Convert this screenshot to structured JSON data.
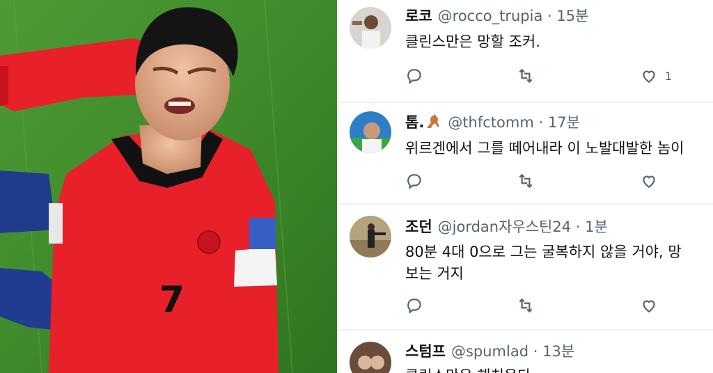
{
  "tweets": [
    {
      "name": "로코",
      "handle": "@rocco_trupia",
      "time": "15분",
      "text": "클린스만은 망할 조커.",
      "text2": "",
      "likes": "1"
    },
    {
      "name": "톰.",
      "handle": "@thfctomm",
      "time": "17분",
      "text": "위르겐에서 그를 떼어내라 이 노발대발한 놈이",
      "text2": "",
      "likes": ""
    },
    {
      "name": "조던",
      "handle": "@jordan자우스틴24",
      "time": "1분",
      "text": "80분 4대 0으로 그는 굴복하지 않을 거야, 망",
      "text2": "보는 거지",
      "likes": ""
    },
    {
      "name": "스텀프",
      "handle": "@spumlad",
      "time": "13분",
      "text": "클린스만은 해치운다",
      "text2": "",
      "likes": ""
    }
  ],
  "separator": "·",
  "icons": {
    "reply": "reply-icon",
    "retweet": "retweet-icon",
    "like": "heart-icon",
    "kangaroo": "kangaroo-emoji"
  },
  "colors": {
    "jersey": "#e8202a",
    "grass": "#3f8a2b",
    "text": "#0f1419",
    "secondary": "#536471"
  },
  "photo": {
    "jersey_number": "7"
  }
}
